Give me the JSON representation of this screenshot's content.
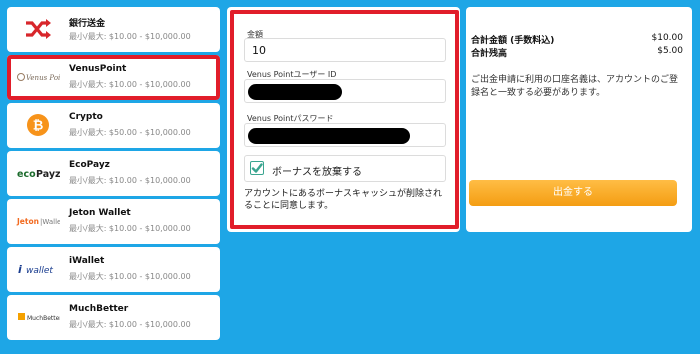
{
  "methods": [
    {
      "name": "銀行送金",
      "limit": "最小/最大: $10.00 - $10,000.00",
      "icon": "shuffle-icon"
    },
    {
      "name": "VenusPoint",
      "limit": "最小/最大: $10.00 - $10,000.00",
      "icon": "venuspoint-logo",
      "logo_text": "Venus Point"
    },
    {
      "name": "Crypto",
      "limit": "最小/最大: $50.00 - $10,000.00",
      "icon": "bitcoin-icon",
      "logo_text": "₿"
    },
    {
      "name": "EcoPayz",
      "limit": "最小/最大: $10.00 - $10,000.00",
      "icon": "ecopayz-logo",
      "logo_text": "ecoPayz"
    },
    {
      "name": "Jeton Wallet",
      "limit": "最小/最大: $10.00 - $10,000.00",
      "icon": "jeton-logo",
      "logo_text": "Jeton|Wallet"
    },
    {
      "name": "iWallet",
      "limit": "最小/最大: $10.00 - $10,000.00",
      "icon": "iwallet-logo",
      "logo_text": "iwallet"
    },
    {
      "name": "MuchBetter",
      "limit": "最小/最大: $10.00 - $10,000.00",
      "icon": "muchbetter-logo",
      "logo_text": "MuchBetter"
    }
  ],
  "form": {
    "amount_label": "金額",
    "amount_value": "10",
    "user_id_label": "Venus Pointユーザー ID",
    "password_label": "Venus Pointパスワード",
    "bonus_label": "ボーナスを放棄する",
    "bonus_checked": true,
    "note": "アカウントにあるボーナスキャッシュが削除されることに同意します。"
  },
  "summary": {
    "total_label": "合計金額 (手数料込)",
    "total_value": "$10.00",
    "balance_label": "合計残高",
    "balance_value": "$5.00",
    "info": "ご出金申請に利用の口座名義は、アカウントのご登録名と一致する必要があります。",
    "withdraw_label": "出金する"
  },
  "colors": {
    "background": "#1ea6e6",
    "highlight": "#e11d2a",
    "button": "#f5a623",
    "check": "#3aa590"
  }
}
